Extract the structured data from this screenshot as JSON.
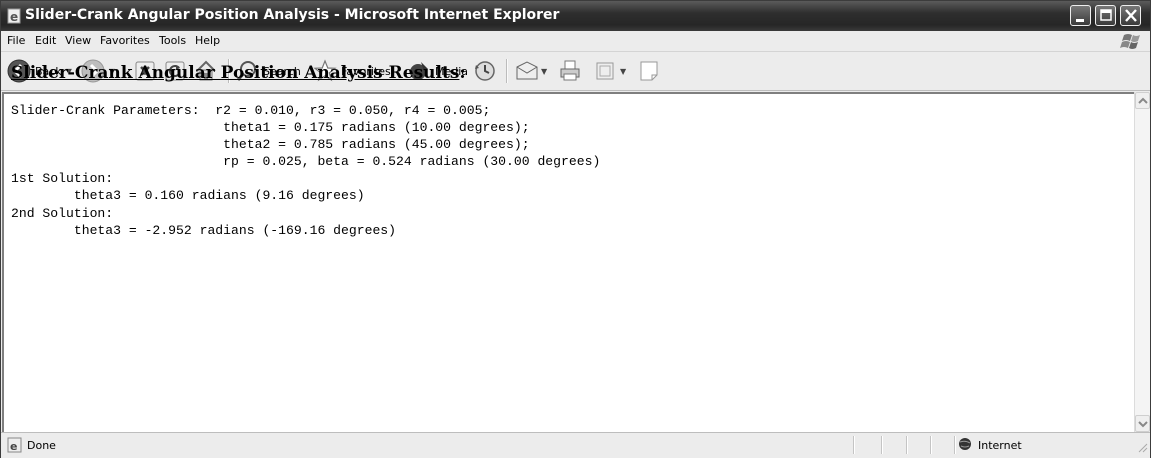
{
  "window": {
    "title": "Slider-Crank Angular Position Analysis - Microsoft Internet Explorer"
  },
  "menu": [
    "File",
    "Edit",
    "View",
    "Favorites",
    "Tools",
    "Help"
  ],
  "toolbar": {
    "back_label": "Back",
    "search_label": "Search",
    "favorites_label": "Favorites",
    "media_label": "Media"
  },
  "content": {
    "heading": "Slider-Crank Angular Position Analysis Results",
    "heading_suffix": ":",
    "lines": [
      "Slider-Crank Parameters:  r2 = 0.010, r3 = 0.050, r4 = 0.005;",
      "                           theta1 = 0.175 radians (10.00 degrees);",
      "                           theta2 = 0.785 radians (45.00 degrees);",
      "                           rp = 0.025, beta = 0.524 radians (30.00 degrees)",
      "1st Solution:",
      "        theta3 = 0.160 radians (9.16 degrees)",
      "2nd Solution:",
      "        theta3 = -2.952 radians (-169.16 degrees)"
    ]
  },
  "status": {
    "text": "Done",
    "zone": "Internet"
  },
  "icons": {
    "title": "ie-page-icon",
    "back": "back-arrow-icon",
    "forward": "forward-arrow-icon",
    "stop": "stop-icon",
    "refresh": "refresh-icon",
    "home": "home-icon",
    "search": "search-icon",
    "favorites": "star-icon",
    "media": "media-icon",
    "history": "history-icon",
    "mail": "mail-icon",
    "print": "print-icon",
    "edit": "edit-icon",
    "discuss": "discuss-icon",
    "zone": "globe-icon"
  }
}
